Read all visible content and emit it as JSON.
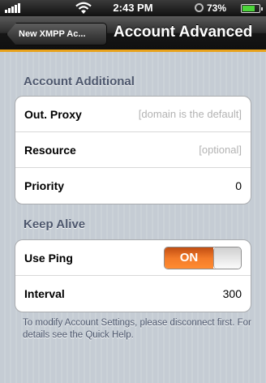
{
  "status_bar": {
    "time": "2:43 PM",
    "battery": "73%",
    "battery_level": 0.73
  },
  "nav": {
    "back_label": "New XMPP Ac...",
    "title": "Account Advanced"
  },
  "sections": {
    "account_additional": {
      "header": "Account Additional",
      "rows": {
        "proxy": {
          "label": "Out. Proxy",
          "placeholder": "[domain is the default]"
        },
        "resource": {
          "label": "Resource",
          "placeholder": "[optional]"
        },
        "priority": {
          "label": "Priority",
          "value": "0"
        }
      }
    },
    "keep_alive": {
      "header": "Keep Alive",
      "rows": {
        "use_ping": {
          "label": "Use Ping",
          "toggle": "ON"
        },
        "interval": {
          "label": "Interval",
          "value": "300"
        }
      }
    }
  },
  "footer_note": "To modify Account Settings, please disconnect first.  For details see the Quick Help.",
  "colors": {
    "accent": "#e8a21c",
    "toggle_on": "#f27a29",
    "section_text": "#4c566c"
  }
}
